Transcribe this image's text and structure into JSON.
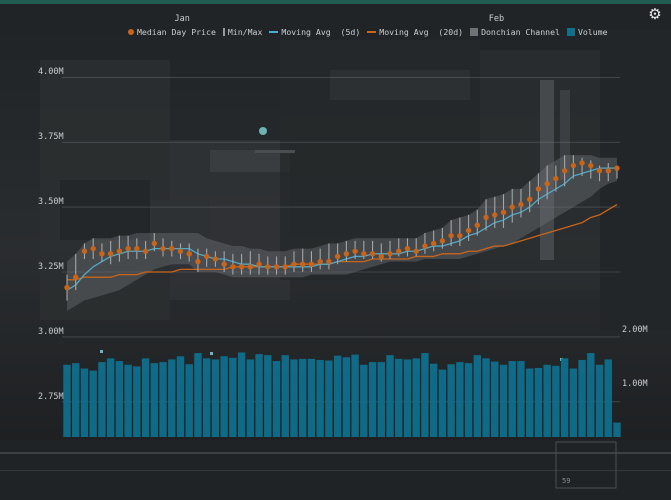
{
  "header": {
    "settings_icon": "gear-icon"
  },
  "legend": [
    {
      "key": "median",
      "label": "Median Day Price",
      "color": "#c8651b",
      "kind": "dot"
    },
    {
      "key": "minmax",
      "label": "Min/Max",
      "color": "#9a9a9a",
      "kind": "bar"
    },
    {
      "key": "ma5",
      "label": "Moving Avg  (5d)",
      "color": "#4fa9c8",
      "kind": "line"
    },
    {
      "key": "ma20",
      "label": "Moving Avg  (20d)",
      "color": "#c8651b",
      "kind": "line"
    },
    {
      "key": "donchian",
      "label": "Donchian Channel",
      "color": "#6e7378",
      "kind": "box"
    },
    {
      "key": "volume",
      "label": "Volume",
      "color": "#0f6f8c",
      "kind": "box"
    }
  ],
  "corner_label": "59",
  "chart_data": {
    "type": "line",
    "x_labels": [
      {
        "index": 13,
        "label": "Jan"
      },
      {
        "index": 49,
        "label": "Feb"
      }
    ],
    "price_axis": {
      "ticks": [
        "4.00M",
        "3.75M",
        "3.50M",
        "3.25M",
        "3.00M",
        "2.75M"
      ],
      "ylim": [
        2.65,
        4.0
      ]
    },
    "volume_axis": {
      "ticks": [
        "2.00M",
        "1.00M"
      ]
    },
    "series": [
      {
        "name": "Median Day Price",
        "values": [
          3.19,
          3.23,
          3.33,
          3.34,
          3.32,
          3.32,
          3.33,
          3.34,
          3.34,
          3.33,
          3.36,
          3.34,
          3.34,
          3.33,
          3.32,
          3.29,
          3.31,
          3.3,
          3.28,
          3.27,
          3.27,
          3.27,
          3.28,
          3.27,
          3.27,
          3.27,
          3.28,
          3.28,
          3.28,
          3.29,
          3.29,
          3.31,
          3.32,
          3.33,
          3.32,
          3.32,
          3.31,
          3.32,
          3.33,
          3.34,
          3.33,
          3.35,
          3.36,
          3.37,
          3.39,
          3.39,
          3.41,
          3.43,
          3.46,
          3.47,
          3.48,
          3.5,
          3.51,
          3.53,
          3.57,
          3.59,
          3.61,
          3.64,
          3.66,
          3.67,
          3.66,
          3.64,
          3.64,
          3.65
        ]
      },
      {
        "name": "Max",
        "values": [
          3.24,
          3.32,
          3.36,
          3.38,
          3.36,
          3.37,
          3.39,
          3.39,
          3.38,
          3.37,
          3.4,
          3.38,
          3.37,
          3.36,
          3.36,
          3.34,
          3.34,
          3.33,
          3.33,
          3.32,
          3.32,
          3.33,
          3.32,
          3.31,
          3.31,
          3.31,
          3.33,
          3.34,
          3.33,
          3.34,
          3.36,
          3.36,
          3.37,
          3.37,
          3.37,
          3.37,
          3.36,
          3.37,
          3.38,
          3.38,
          3.38,
          3.4,
          3.41,
          3.42,
          3.45,
          3.46,
          3.47,
          3.49,
          3.53,
          3.54,
          3.55,
          3.57,
          3.57,
          3.6,
          3.63,
          3.66,
          3.66,
          3.7,
          3.7,
          3.69,
          3.68,
          3.66,
          3.67,
          3.66
        ]
      },
      {
        "name": "Min",
        "values": [
          3.14,
          3.18,
          3.3,
          3.3,
          3.29,
          3.28,
          3.29,
          3.3,
          3.3,
          3.3,
          3.33,
          3.31,
          3.31,
          3.3,
          3.29,
          3.25,
          3.27,
          3.27,
          3.25,
          3.24,
          3.24,
          3.24,
          3.24,
          3.24,
          3.24,
          3.24,
          3.25,
          3.25,
          3.25,
          3.26,
          3.26,
          3.28,
          3.29,
          3.3,
          3.3,
          3.3,
          3.29,
          3.3,
          3.31,
          3.31,
          3.31,
          3.32,
          3.33,
          3.34,
          3.35,
          3.35,
          3.37,
          3.39,
          3.41,
          3.42,
          3.42,
          3.44,
          3.46,
          3.48,
          3.51,
          3.53,
          3.56,
          3.58,
          3.61,
          3.62,
          3.61,
          3.6,
          3.6,
          3.61
        ]
      },
      {
        "name": "Moving Avg (5d)",
        "values": [
          3.18,
          3.2,
          3.24,
          3.27,
          3.29,
          3.31,
          3.32,
          3.33,
          3.33,
          3.33,
          3.34,
          3.34,
          3.34,
          3.34,
          3.34,
          3.32,
          3.31,
          3.3,
          3.3,
          3.29,
          3.28,
          3.28,
          3.27,
          3.27,
          3.27,
          3.27,
          3.27,
          3.27,
          3.27,
          3.28,
          3.28,
          3.29,
          3.3,
          3.31,
          3.31,
          3.32,
          3.32,
          3.32,
          3.32,
          3.33,
          3.33,
          3.34,
          3.35,
          3.35,
          3.36,
          3.37,
          3.39,
          3.4,
          3.42,
          3.44,
          3.45,
          3.47,
          3.48,
          3.5,
          3.53,
          3.55,
          3.57,
          3.59,
          3.62,
          3.63,
          3.64,
          3.65,
          3.65,
          3.65
        ]
      },
      {
        "name": "Moving Avg (20d)",
        "values": [
          3.22,
          3.22,
          3.23,
          3.23,
          3.23,
          3.23,
          3.24,
          3.24,
          3.24,
          3.25,
          3.25,
          3.25,
          3.25,
          3.26,
          3.26,
          3.26,
          3.26,
          3.26,
          3.26,
          3.27,
          3.27,
          3.27,
          3.27,
          3.27,
          3.27,
          3.27,
          3.28,
          3.28,
          3.28,
          3.28,
          3.28,
          3.29,
          3.29,
          3.29,
          3.29,
          3.3,
          3.3,
          3.3,
          3.3,
          3.3,
          3.31,
          3.31,
          3.31,
          3.32,
          3.32,
          3.32,
          3.33,
          3.33,
          3.34,
          3.35,
          3.35,
          3.36,
          3.37,
          3.38,
          3.39,
          3.4,
          3.41,
          3.42,
          3.43,
          3.44,
          3.46,
          3.47,
          3.49,
          3.51
        ]
      },
      {
        "name": "Donchian Upper",
        "values": [
          3.29,
          3.32,
          3.36,
          3.38,
          3.38,
          3.38,
          3.39,
          3.39,
          3.4,
          3.4,
          3.4,
          3.4,
          3.4,
          3.4,
          3.4,
          3.4,
          3.38,
          3.37,
          3.36,
          3.35,
          3.35,
          3.34,
          3.34,
          3.33,
          3.33,
          3.33,
          3.34,
          3.34,
          3.34,
          3.35,
          3.36,
          3.36,
          3.37,
          3.38,
          3.38,
          3.38,
          3.38,
          3.38,
          3.38,
          3.38,
          3.38,
          3.4,
          3.41,
          3.42,
          3.45,
          3.46,
          3.47,
          3.49,
          3.53,
          3.54,
          3.55,
          3.57,
          3.57,
          3.6,
          3.63,
          3.66,
          3.68,
          3.7,
          3.7,
          3.7,
          3.7,
          3.69,
          3.69,
          3.69
        ]
      },
      {
        "name": "Donchian Lower",
        "values": [
          3.1,
          3.12,
          3.14,
          3.15,
          3.16,
          3.17,
          3.18,
          3.2,
          3.22,
          3.24,
          3.26,
          3.27,
          3.28,
          3.28,
          3.28,
          3.25,
          3.25,
          3.25,
          3.24,
          3.23,
          3.23,
          3.23,
          3.23,
          3.23,
          3.23,
          3.23,
          3.23,
          3.23,
          3.24,
          3.24,
          3.24,
          3.24,
          3.24,
          3.25,
          3.26,
          3.27,
          3.28,
          3.29,
          3.29,
          3.29,
          3.29,
          3.3,
          3.3,
          3.3,
          3.3,
          3.3,
          3.31,
          3.32,
          3.33,
          3.34,
          3.35,
          3.36,
          3.38,
          3.4,
          3.42,
          3.44,
          3.46,
          3.48,
          3.5,
          3.52,
          3.54,
          3.57,
          3.59,
          3.6
        ]
      },
      {
        "name": "Volume",
        "values": [
          1.35,
          1.38,
          1.28,
          1.24,
          1.4,
          1.47,
          1.42,
          1.35,
          1.32,
          1.47,
          1.38,
          1.4,
          1.45,
          1.51,
          1.36,
          1.57,
          1.47,
          1.45,
          1.51,
          1.48,
          1.58,
          1.45,
          1.55,
          1.53,
          1.42,
          1.53,
          1.45,
          1.46,
          1.46,
          1.44,
          1.43,
          1.52,
          1.49,
          1.54,
          1.35,
          1.4,
          1.4,
          1.53,
          1.46,
          1.45,
          1.47,
          1.57,
          1.37,
          1.26,
          1.36,
          1.4,
          1.38,
          1.53,
          1.47,
          1.41,
          1.35,
          1.42,
          1.42,
          1.28,
          1.29,
          1.35,
          1.33,
          1.47,
          1.28,
          1.44,
          1.57,
          1.35,
          1.45,
          0.27
        ]
      }
    ]
  }
}
